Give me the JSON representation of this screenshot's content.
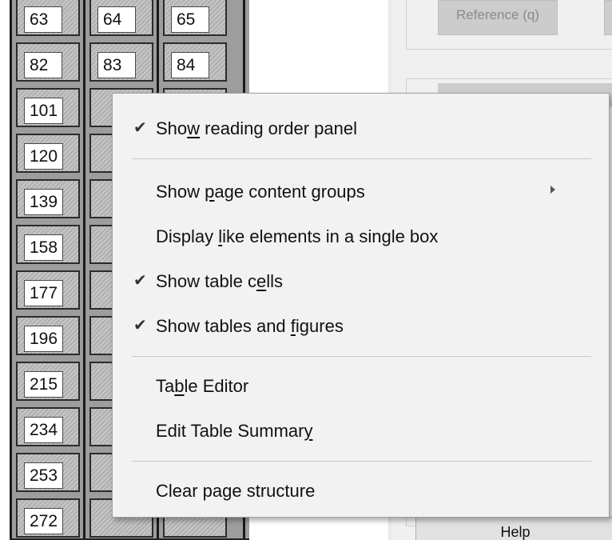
{
  "document": {
    "visible_cell_rows": [
      [
        "63",
        "64",
        "65"
      ],
      [
        "82",
        "83",
        "84"
      ],
      [
        "101",
        "",
        ""
      ],
      [
        "120",
        "",
        ""
      ],
      [
        "139",
        "",
        ""
      ],
      [
        "158",
        "",
        ""
      ],
      [
        "177",
        "",
        ""
      ],
      [
        "196",
        "",
        ""
      ],
      [
        "215",
        "",
        ""
      ],
      [
        "234",
        "",
        ""
      ],
      [
        "253",
        "",
        ""
      ],
      [
        "272",
        "",
        ""
      ]
    ]
  },
  "pane": {
    "reference_button": "Reference (q)",
    "help_button": "Help"
  },
  "context_menu": {
    "items": [
      {
        "label": "Show reading order panel",
        "checked": true,
        "submenu": false
      },
      {
        "label": "Show page content groups",
        "checked": false,
        "submenu": true
      },
      {
        "label": "Display like elements in a single box",
        "checked": false,
        "submenu": false
      },
      {
        "label": "Show table cells",
        "checked": true,
        "submenu": false
      },
      {
        "label": "Show tables and figures",
        "checked": true,
        "submenu": false
      },
      {
        "label": "Table Editor",
        "checked": false,
        "submenu": false
      },
      {
        "label": "Edit Table Summary",
        "checked": false,
        "submenu": false
      },
      {
        "label": "Clear page structure",
        "checked": false,
        "submenu": false
      }
    ],
    "check_glyph": "✔"
  },
  "colors": {
    "menu_background": "#f2f2f2",
    "cell_fill": "#b9b9b9",
    "pane_background": "#f0f0f0",
    "disabled_text": "#8a8a8a"
  }
}
